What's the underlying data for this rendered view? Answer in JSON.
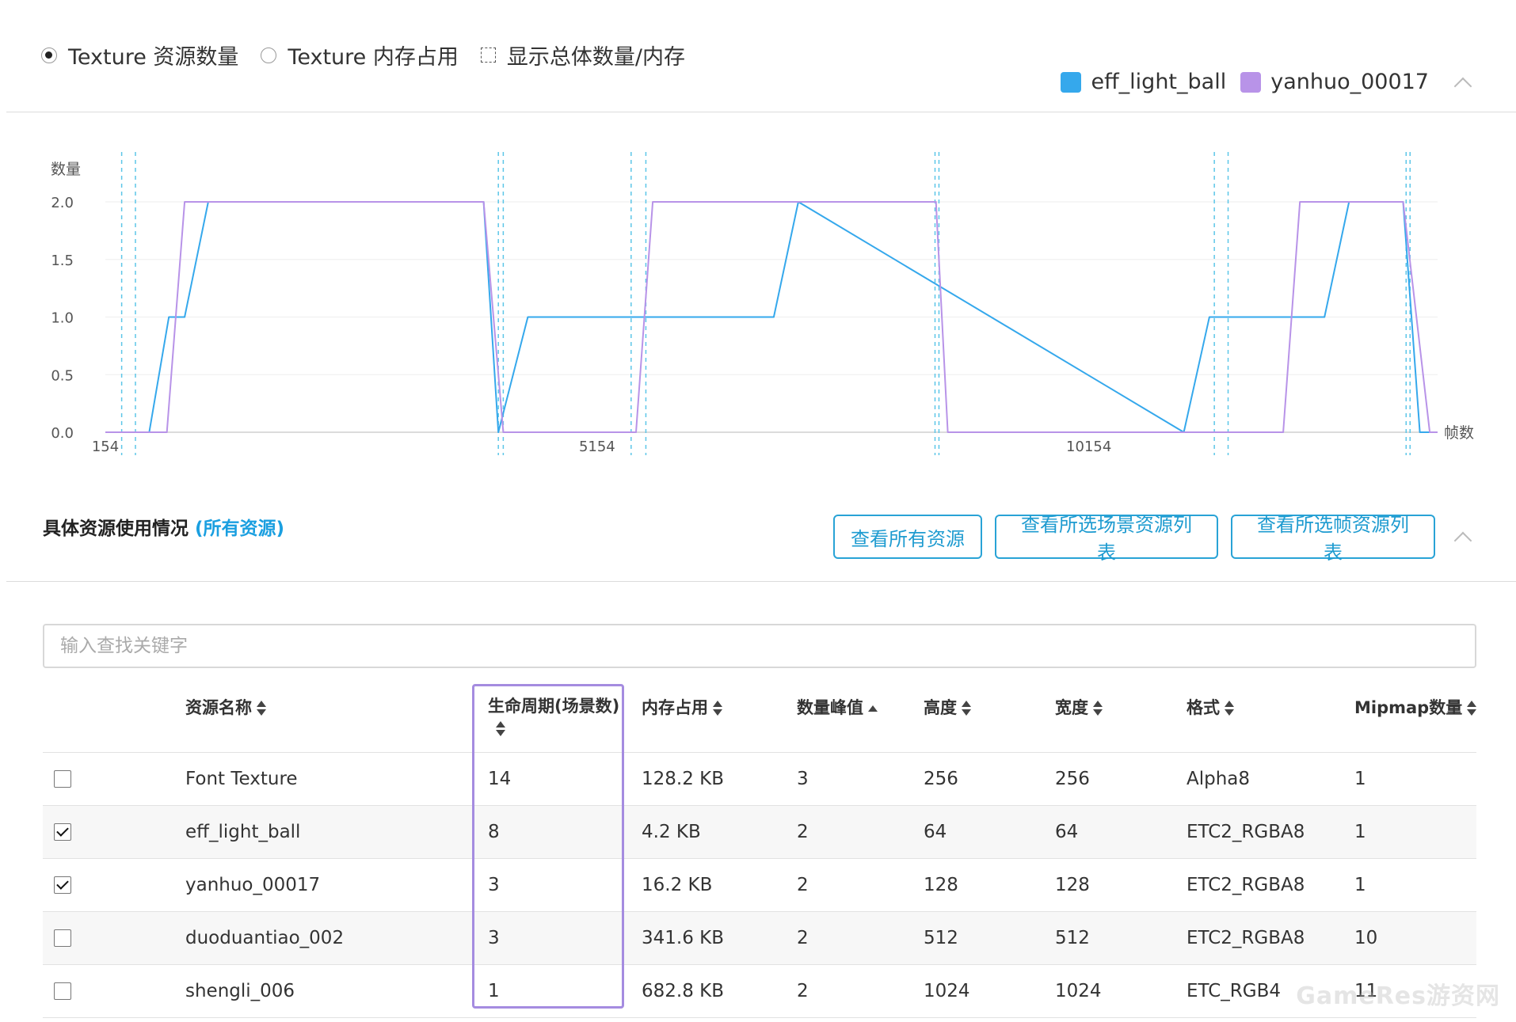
{
  "options": {
    "radio_count": "Texture 资源数量",
    "radio_memory": "Texture 内存占用",
    "checkbox_total": "显示总体数量/内存",
    "selected": "count"
  },
  "legend": [
    {
      "name": "eff_light_ball",
      "color": "#35a8ec"
    },
    {
      "name": "yanhuo_00017",
      "color": "#b893e8"
    }
  ],
  "chart_data": {
    "type": "line",
    "ylabel": "数量",
    "xlabel": "帧数",
    "ylim": [
      0,
      2.0
    ],
    "yticks": [
      "0.0",
      "0.5",
      "1.0",
      "1.5",
      "2.0"
    ],
    "xlim": [
      154,
      13700
    ],
    "xticks": [
      {
        "value": 154,
        "label": "154"
      },
      {
        "value": 5154,
        "label": "5154"
      },
      {
        "value": 10154,
        "label": "10154"
      }
    ],
    "grid": true,
    "scene_markers": [
      {
        "pair": [
          320,
          460
        ]
      },
      {
        "pair": [
          4150,
          4200
        ]
      },
      {
        "pair": [
          5500,
          5650
        ]
      },
      {
        "pair": [
          8590,
          8630
        ]
      },
      {
        "pair": [
          11430,
          11570
        ]
      },
      {
        "pair": [
          13380,
          13420
        ]
      }
    ],
    "series": [
      {
        "name": "eff_light_ball",
        "color": "#35a8ec",
        "x": [
          154,
          600,
          800,
          960,
          1200,
          4000,
          4150,
          4450,
          6950,
          7200,
          11120,
          11380,
          12550,
          12800,
          13350,
          13520,
          13700
        ],
        "y": [
          0,
          0,
          1,
          1,
          2,
          2,
          0,
          1,
          1,
          2,
          0,
          1,
          1,
          2,
          2,
          0,
          0
        ]
      },
      {
        "name": "yanhuo_00017",
        "color": "#b893e8",
        "x": [
          154,
          780,
          960,
          4000,
          4200,
          5550,
          5720,
          8600,
          8720,
          12130,
          12300,
          13350,
          13620,
          13700
        ],
        "y": [
          0,
          0,
          2,
          2,
          0,
          0,
          2,
          2,
          0,
          0,
          2,
          2,
          0,
          0
        ]
      }
    ]
  },
  "section": {
    "title": "具体资源使用情况 ",
    "link": "(所有资源)",
    "buttons": [
      "查看所有资源",
      "查看所选场景资源列表",
      "查看所选帧资源列表"
    ]
  },
  "search": {
    "placeholder": "输入查找关键字",
    "value": ""
  },
  "table": {
    "columns": [
      {
        "label": "资源名称",
        "sort": "both"
      },
      {
        "label": "生命周期(场景数)",
        "sort": "both"
      },
      {
        "label": "内存占用",
        "sort": "both"
      },
      {
        "label": "数量峰值",
        "sort": "asc"
      },
      {
        "label": "高度",
        "sort": "both"
      },
      {
        "label": "宽度",
        "sort": "both"
      },
      {
        "label": "格式",
        "sort": "both"
      },
      {
        "label": "Mipmap数量",
        "sort": "both"
      }
    ],
    "rows": [
      {
        "checked": false,
        "cells": [
          "Font Texture",
          "14",
          "128.2 KB",
          "3",
          "256",
          "256",
          "Alpha8",
          "1"
        ]
      },
      {
        "checked": true,
        "cells": [
          "eff_light_ball",
          "8",
          "4.2 KB",
          "2",
          "64",
          "64",
          "ETC2_RGBA8",
          "1"
        ]
      },
      {
        "checked": true,
        "cells": [
          "yanhuo_00017",
          "3",
          "16.2 KB",
          "2",
          "128",
          "128",
          "ETC2_RGBA8",
          "1"
        ]
      },
      {
        "checked": false,
        "cells": [
          "duoduantiao_002",
          "3",
          "341.6 KB",
          "2",
          "512",
          "512",
          "ETC2_RGBA8",
          "10"
        ]
      },
      {
        "checked": false,
        "cells": [
          "shengli_006",
          "1",
          "682.8 KB",
          "2",
          "1024",
          "1024",
          "ETC_RGB4",
          "11"
        ]
      }
    ]
  },
  "watermark": "GameRes游资网"
}
